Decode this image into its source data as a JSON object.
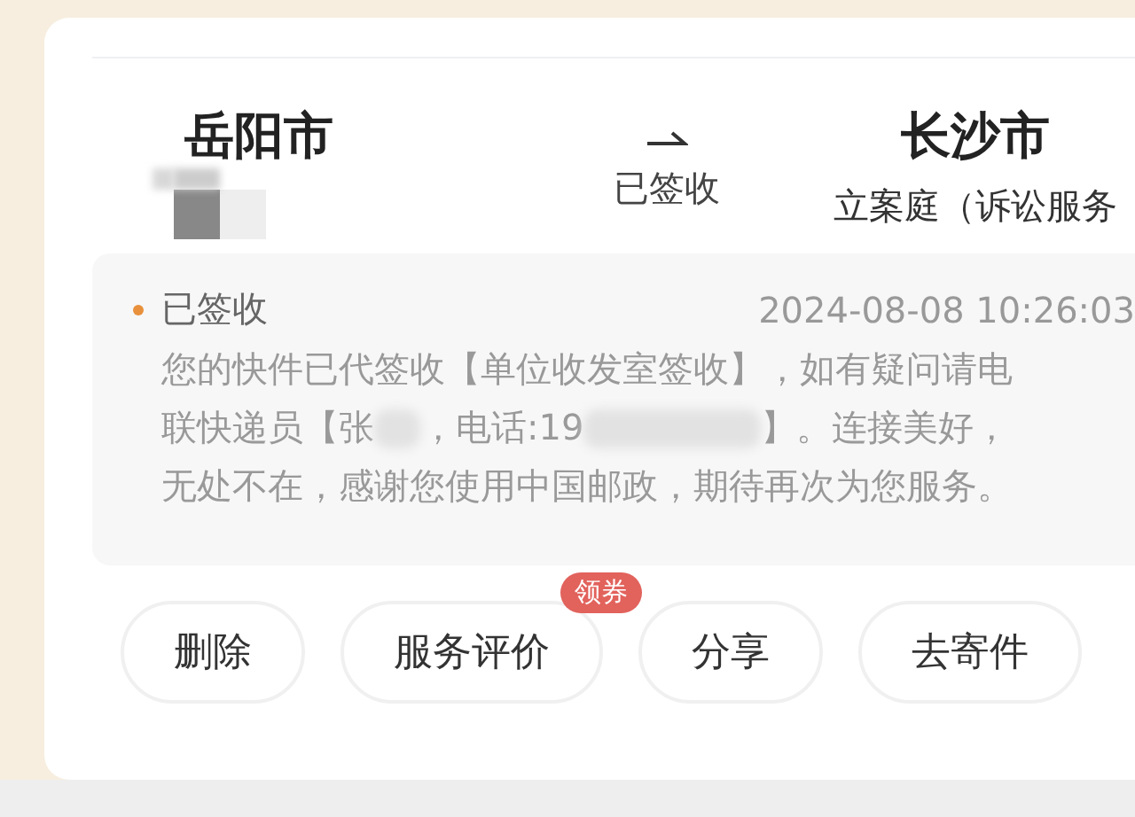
{
  "route": {
    "origin": {
      "city": "岳阳市",
      "detail_redacted": true
    },
    "status": "已签收",
    "destination": {
      "city": "长沙市",
      "place": "立案庭（诉讼服务"
    }
  },
  "timeline": [
    {
      "status": "已签收",
      "time": "2024-08-08 10:26:03",
      "current": true,
      "lines": [
        [
          {
            "kind": "text",
            "text": "您的快件已代签收【单位收发室签收】，如有疑问请电"
          }
        ],
        [
          {
            "kind": "text",
            "text": "联快递员【张"
          },
          {
            "kind": "redacted-short"
          },
          {
            "kind": "text",
            "text": "，电话:19"
          },
          {
            "kind": "redacted-long"
          },
          {
            "kind": "text",
            "text": "】。连接美好，"
          }
        ],
        [
          {
            "kind": "text",
            "text": "无处不在，感谢您使用中国邮政，期待再次为您服务。"
          }
        ]
      ]
    }
  ],
  "actions": [
    {
      "label": "删除"
    },
    {
      "label": "服务评价",
      "badge": "领券"
    },
    {
      "label": "分享"
    },
    {
      "label": "去寄件"
    }
  ]
}
